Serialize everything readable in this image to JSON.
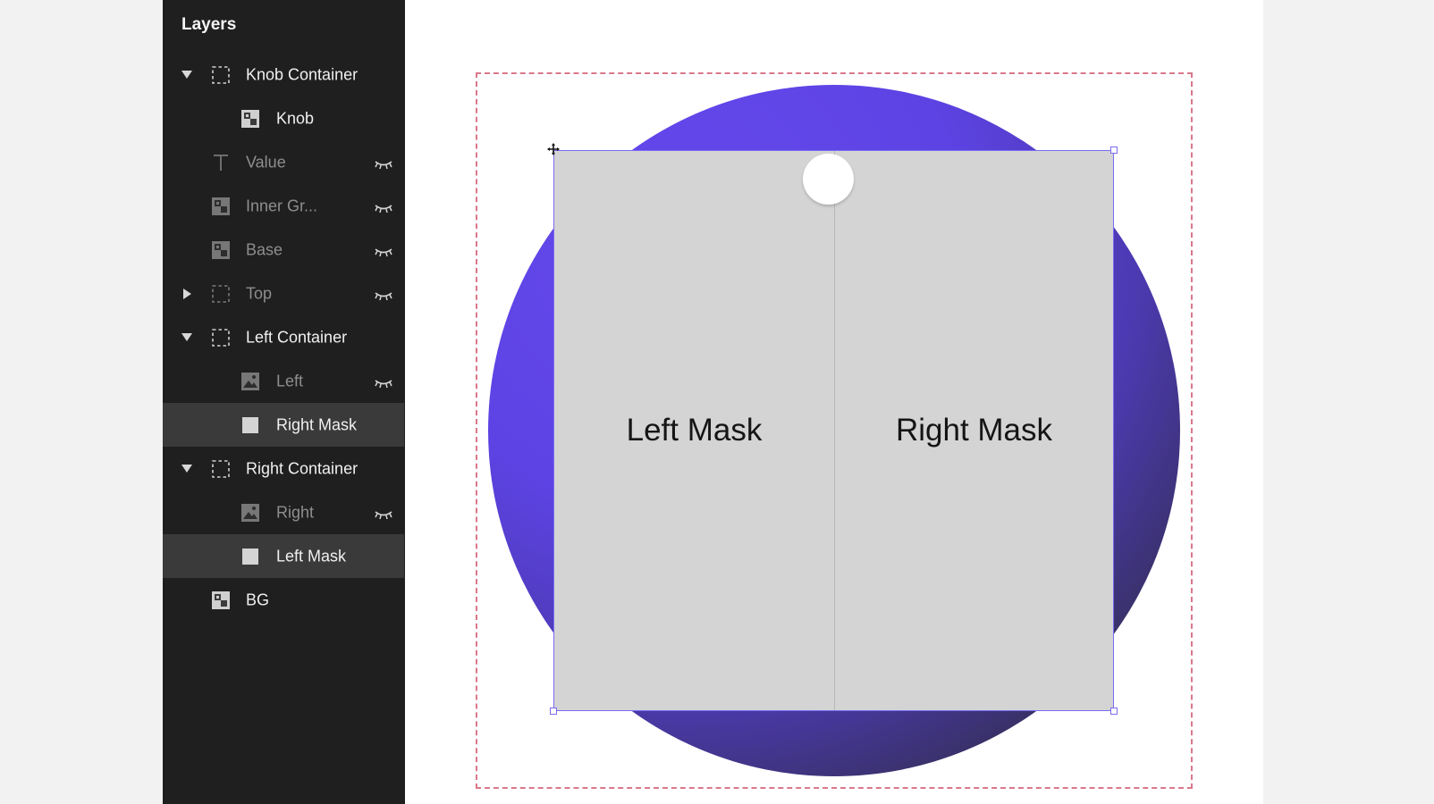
{
  "panel": {
    "title": "Layers",
    "layers": [
      {
        "label": "Knob Container",
        "type": "group",
        "level": 0,
        "arrow": "down",
        "hidden": false,
        "selected": false,
        "icon": "dashed-frame-icon"
      },
      {
        "label": "Knob",
        "type": "component",
        "level": 1,
        "arrow": "",
        "hidden": false,
        "selected": false,
        "icon": "component-icon"
      },
      {
        "label": "Value",
        "type": "text",
        "level": 0,
        "arrow": "",
        "hidden": true,
        "selected": false,
        "icon": "text-icon"
      },
      {
        "label": "Inner Gr...",
        "type": "component",
        "level": 0,
        "arrow": "",
        "hidden": true,
        "selected": false,
        "icon": "component-icon"
      },
      {
        "label": "Base",
        "type": "component",
        "level": 0,
        "arrow": "",
        "hidden": true,
        "selected": false,
        "icon": "component-icon"
      },
      {
        "label": "Top",
        "type": "group",
        "level": 0,
        "arrow": "right",
        "hidden": true,
        "selected": false,
        "icon": "dashed-frame-icon"
      },
      {
        "label": "Left Container",
        "type": "group",
        "level": 0,
        "arrow": "down",
        "hidden": false,
        "selected": false,
        "icon": "dashed-frame-icon"
      },
      {
        "label": "Left",
        "type": "image",
        "level": 1,
        "arrow": "",
        "hidden": true,
        "selected": false,
        "icon": "image-icon"
      },
      {
        "label": "Right Mask",
        "type": "rectangle",
        "level": 1,
        "arrow": "",
        "hidden": false,
        "selected": true,
        "icon": "rectangle-icon"
      },
      {
        "label": "Right Container",
        "type": "group",
        "level": 0,
        "arrow": "down",
        "hidden": false,
        "selected": false,
        "icon": "dashed-frame-icon"
      },
      {
        "label": "Right",
        "type": "image",
        "level": 1,
        "arrow": "",
        "hidden": true,
        "selected": false,
        "icon": "image-icon"
      },
      {
        "label": "Left Mask",
        "type": "rectangle",
        "level": 1,
        "arrow": "",
        "hidden": false,
        "selected": true,
        "icon": "rectangle-icon"
      },
      {
        "label": "BG",
        "type": "component",
        "level": 0,
        "arrow": "",
        "hidden": false,
        "selected": false,
        "icon": "component-icon"
      }
    ]
  },
  "canvas": {
    "left_mask_label": "Left Mask",
    "right_mask_label": "Right Mask",
    "colors": {
      "accent": "#7a6cf2",
      "disc": "#5d43e4",
      "mask": "#d4d4d4",
      "frame_outline": "#d9788a"
    }
  }
}
